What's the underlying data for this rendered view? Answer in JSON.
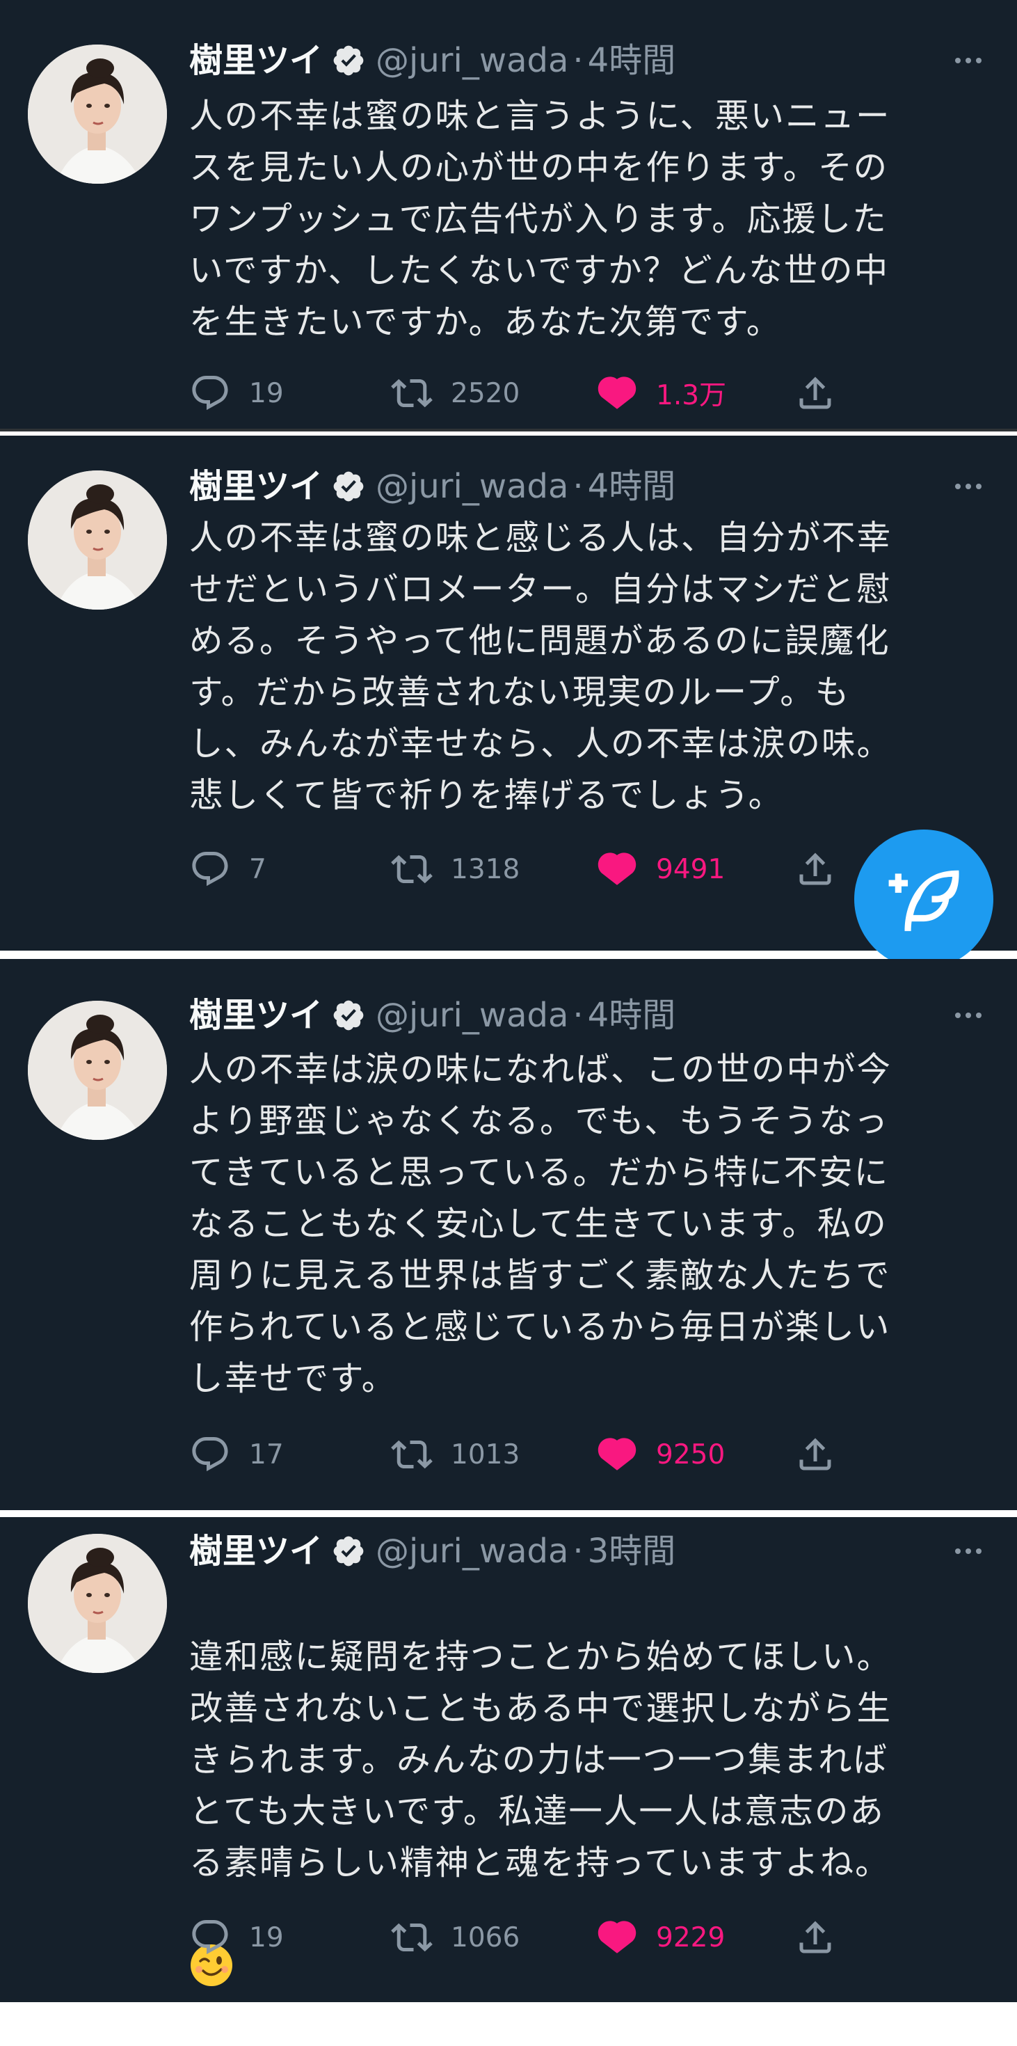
{
  "tweets": [
    {
      "name": "樹里ツイ",
      "handle": "@juri_wada",
      "separator": "·",
      "time": "4時間",
      "text": "人の不幸は蜜の味と言うように、悪いニュー\nスを見たい人の心が世の中を作ります。その\nワンプッシュで広告代が入ります。応援した\nいですか、したくないですか？どんな世の中\nを生きたいですか。あなた次第です。",
      "replies": "19",
      "retweets": "2520",
      "likes": "1.3万"
    },
    {
      "name": "樹里ツイ",
      "handle": "@juri_wada",
      "separator": "·",
      "time": "4時間",
      "text": "人の不幸は蜜の味と感じる人は、自分が不幸\nせだというバロメーター。自分はマシだと慰\nめる。そうやって他に問題があるのに誤魔化\nす。だから改善されない現実のループ。も\nし、みんなが幸せなら、人の不幸は涙の味。\n悲しくて皆で祈りを捧げるでしょう。",
      "replies": "7",
      "retweets": "1318",
      "likes": "9491"
    },
    {
      "name": "樹里ツイ",
      "handle": "@juri_wada",
      "separator": "·",
      "time": "4時間",
      "text": "人の不幸は涙の味になれば、この世の中が今\nより野蛮じゃなくなる。でも、もうそうなっ\nてきていると思っている。だから特に不安に\nなることもなく安心して生きています。私の\n周りに見える世界は皆すごく素敵な人たちで\n作られていると感じているから毎日が楽しい\nし幸せです。",
      "replies": "17",
      "retweets": "1013",
      "likes": "9250"
    },
    {
      "name": "樹里ツイ",
      "handle": "@juri_wada",
      "separator": "·",
      "time": "3時間",
      "text": "違和感に疑問を持つことから始めてほしい。\n改善されないこともある中で選択しながら生\nきられます。みんなの力は一つ一つ集まれば\nとても大きいです。私達一人一人は意志のあ\nる素晴らしい精神と魂を持っていますよね。",
      "emoji": "😉",
      "replies": "19",
      "retweets": "1066",
      "likes": "9229"
    }
  ],
  "colors": {
    "background": "#15202b",
    "text": "#e7e9ea",
    "secondary": "#8b98a5",
    "like": "#f91880",
    "accent": "#1d9bf0"
  },
  "icons": [
    "verified-badge-icon",
    "more-icon",
    "reply-icon",
    "retweet-icon",
    "like-heart-icon",
    "share-icon",
    "compose-tweet-icon"
  ]
}
